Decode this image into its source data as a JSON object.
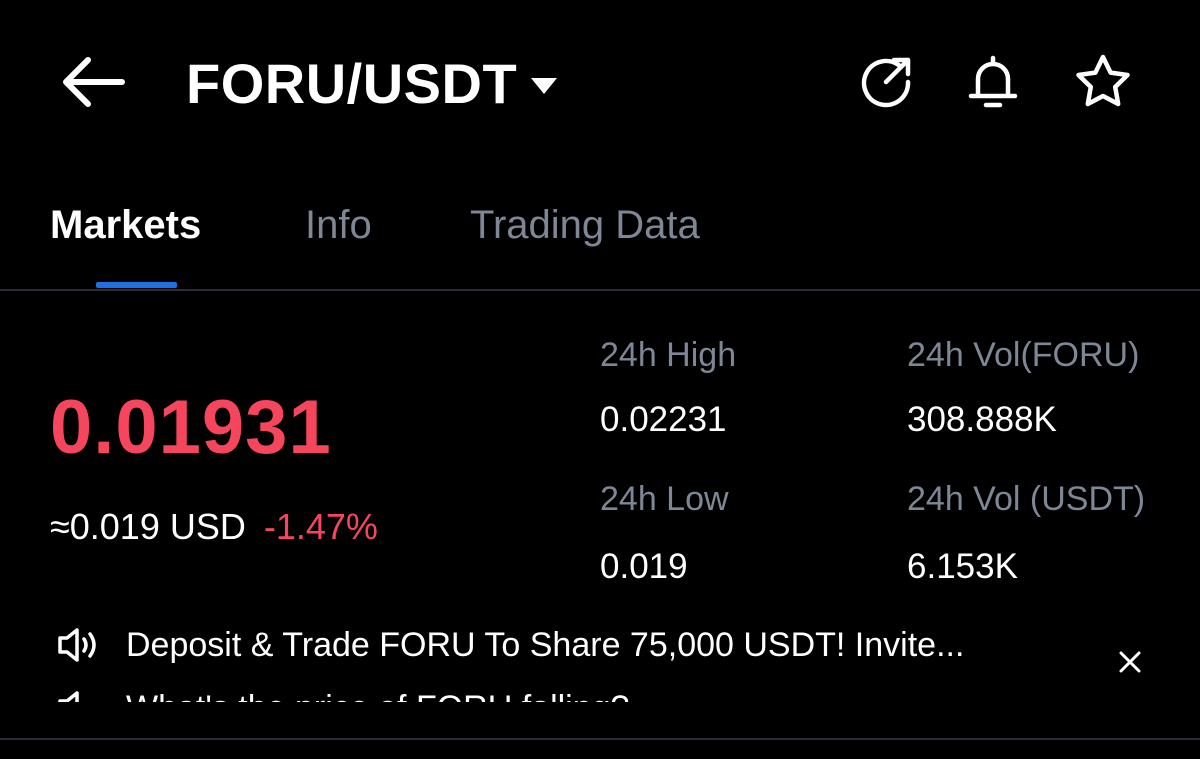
{
  "header": {
    "pair": "FORU/USDT",
    "icons": [
      "back-arrow-icon",
      "caret-down-icon",
      "refresh-icon",
      "bell-icon",
      "star-icon"
    ]
  },
  "tabs": [
    {
      "label": "Markets",
      "active": true
    },
    {
      "label": "Info",
      "active": false
    },
    {
      "label": "Trading Data",
      "active": false
    }
  ],
  "price": {
    "last": "0.01931",
    "usd_approx": "≈0.019 USD",
    "change_pct": "-1.47%"
  },
  "stats": {
    "high_24h_label": "24h High",
    "high_24h_value": "0.02231",
    "vol_foru_label": "24h Vol(FORU)",
    "vol_foru_value": "308.888K",
    "low_24h_label": "24h Low",
    "low_24h_value": "0.019",
    "vol_usdt_label": "24h Vol (USDT)",
    "vol_usdt_value": "6.153K"
  },
  "announcement": {
    "text": "Deposit & Trade FORU To Share  75,000 USDT! Invite...",
    "next_text": "What's the price of FORU falling?",
    "icons": [
      "speaker-icon",
      "close-icon"
    ]
  },
  "colors": {
    "background": "#000000",
    "text_primary": "#ffffff",
    "text_secondary": "#7e8796",
    "price_down": "#f6465d",
    "accent": "#1f6fe5",
    "divider": "#2a2d33"
  }
}
